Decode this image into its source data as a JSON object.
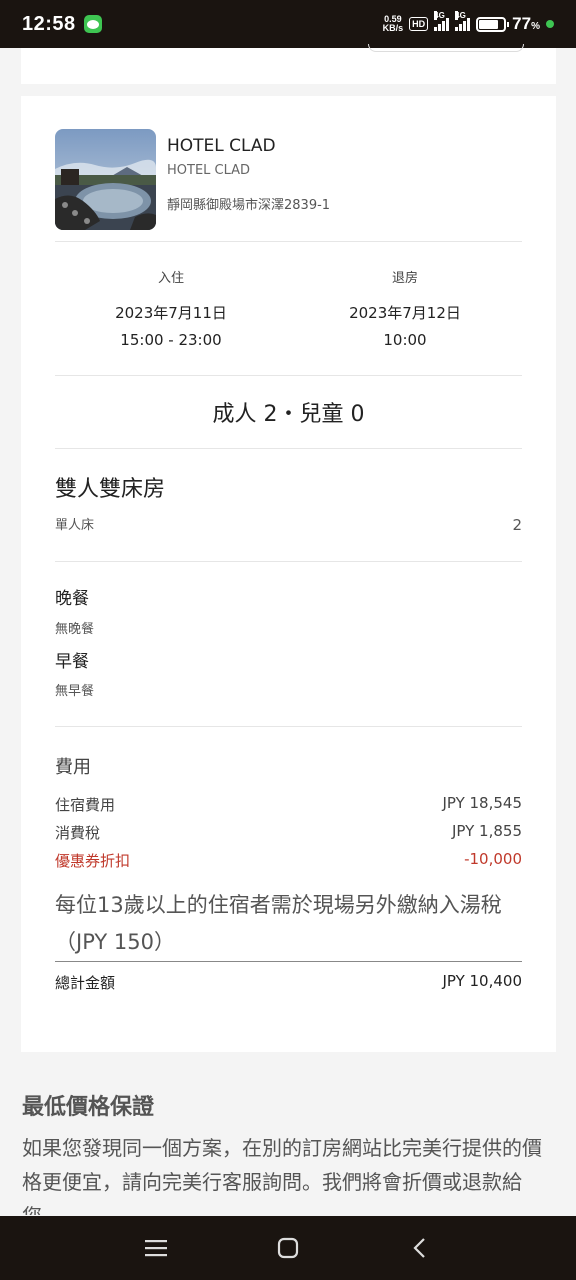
{
  "status": {
    "time": "12:58",
    "net_speed_value": "0.59",
    "net_speed_unit": "KB/s",
    "hd": "HD",
    "net1": "4G",
    "net2": "4G",
    "battery_pct": "77",
    "battery_unit": "%",
    "battery_level": 0.77
  },
  "hotel": {
    "name": "HOTEL CLAD",
    "name_sub": "HOTEL CLAD",
    "address": "靜岡縣御殿場市深澤2839-1",
    "image_icon": "hotel-photo"
  },
  "checkin": {
    "label": "入住",
    "date": "2023年7月11日",
    "time": "15:00 - 23:00"
  },
  "checkout": {
    "label": "退房",
    "date": "2023年7月12日",
    "time": "10:00"
  },
  "guests": "成人 2・兒童 0",
  "room": {
    "name": "雙人雙床房",
    "bed_type": "單人床",
    "bed_count": "2"
  },
  "meals": {
    "dinner_title": "晚餐",
    "dinner_value": "無晚餐",
    "breakfast_title": "早餐",
    "breakfast_value": "無早餐"
  },
  "fees": {
    "title": "費用",
    "rows": [
      {
        "label": "住宿費用",
        "value": "JPY 18,545"
      },
      {
        "label": "消費稅",
        "value": "JPY 1,855"
      },
      {
        "label": "優惠券折扣",
        "value": "-10,000"
      }
    ],
    "note": "每位13歲以上的住宿者需於現場另外繳納入湯稅（JPY 150）",
    "total_label": "總計金額",
    "total_value": "JPY 10,400"
  },
  "guarantee": {
    "title": "最低價格保證",
    "text": "如果您發現同一個方案，在別的訂房網站比完美行提供的價格更便宜，請向完美行客服詢問。我們將會折價或退款給您。"
  },
  "colors": {
    "discount": "#c0392b",
    "status_bg": "#1a1410",
    "line_green": "#3ec552"
  },
  "nav": {
    "icons": [
      "recent-apps-icon",
      "home-icon",
      "back-icon"
    ]
  }
}
